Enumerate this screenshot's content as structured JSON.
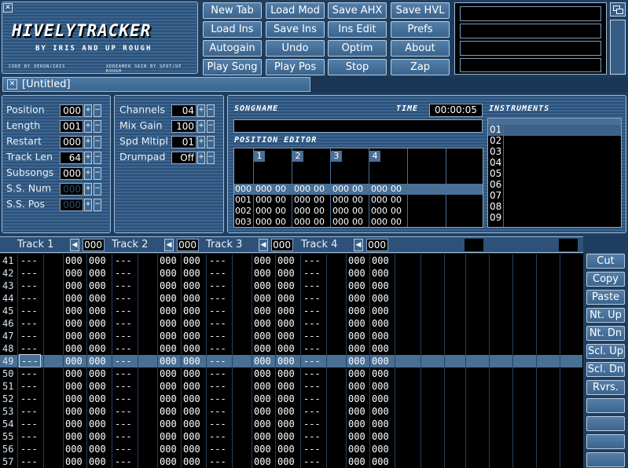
{
  "logo": {
    "title": "HIVELYTRACKER",
    "subtitle": "BY IRIS AND UP ROUGH",
    "credit_left": "CODE BY XERON/IRIS",
    "credit_right": "XDREAMER SKIN BY SPOT/UP ROUGH"
  },
  "toolbar": {
    "row1": [
      "New Tab",
      "Load Mod",
      "Save AHX",
      "Save HVL"
    ],
    "row2": [
      "Load Ins",
      "Save Ins",
      "Ins Edit",
      "Prefs"
    ],
    "row3": [
      "Autogain",
      "Undo",
      "Optim",
      "About"
    ],
    "row4": [
      "Play Song",
      "Play Pos",
      "Stop",
      "Zap"
    ]
  },
  "tab": {
    "title": "[Untitled]"
  },
  "settings_left": [
    {
      "label": "Position",
      "value": "000"
    },
    {
      "label": "Length",
      "value": "001"
    },
    {
      "label": "Restart",
      "value": "000"
    },
    {
      "label": "Track Len",
      "value": "64"
    },
    {
      "label": "Subsongs",
      "value": "000"
    },
    {
      "label": "S.S. Num",
      "value": "000"
    },
    {
      "label": "S.S. Pos",
      "value": "000"
    }
  ],
  "settings_mid": [
    {
      "label": "Channels",
      "value": "04"
    },
    {
      "label": "Mix Gain",
      "value": "100"
    },
    {
      "label": "Spd Mltipl",
      "value": "01"
    },
    {
      "label": "Drumpad",
      "value": "Off"
    }
  ],
  "song": {
    "songname_label": "SONGNAME",
    "time_label": "TIME",
    "time_value": "00:00:05",
    "posed_label": "POSITION EDITOR",
    "instruments_label": "INSTRUMENTS",
    "channels": [
      "1",
      "2",
      "3",
      "4"
    ],
    "rows": [
      {
        "num": "000",
        "cells": [
          "000",
          "00",
          "000",
          "00",
          "000",
          "00",
          "000",
          "00"
        ]
      },
      {
        "num": "001",
        "cells": [
          "000",
          "00",
          "000",
          "00",
          "000",
          "00",
          "000",
          "00"
        ]
      },
      {
        "num": "002",
        "cells": [
          "000",
          "00",
          "000",
          "00",
          "000",
          "00",
          "000",
          "00"
        ]
      },
      {
        "num": "003",
        "cells": [
          "000",
          "00",
          "000",
          "00",
          "000",
          "00",
          "000",
          "00"
        ]
      }
    ],
    "instruments": [
      "01",
      "02",
      "03",
      "04",
      "05",
      "06",
      "07",
      "08",
      "09"
    ]
  },
  "tracks": [
    {
      "label": "Track 1",
      "value": "000"
    },
    {
      "label": "Track 2",
      "value": "000"
    },
    {
      "label": "Track 3",
      "value": "000"
    },
    {
      "label": "Track 4",
      "value": "000"
    }
  ],
  "pattern": {
    "note_blank": "---",
    "zero": "000",
    "rows": [
      "41",
      "42",
      "43",
      "44",
      "45",
      "46",
      "47",
      "48",
      "49",
      "50",
      "51",
      "52",
      "53",
      "54",
      "55",
      "56",
      "57"
    ],
    "highlight_row": "49"
  },
  "side_buttons": [
    "Cut",
    "Copy",
    "Paste",
    "Nt. Up",
    "Nt. Dn",
    "Scl. Up",
    "Scl. Dn",
    "Rvrs.",
    "",
    "",
    "",
    ""
  ],
  "colors": {
    "background": "#1f3e5f",
    "panel": "#2d5178",
    "highlight": "#4a6f95"
  }
}
